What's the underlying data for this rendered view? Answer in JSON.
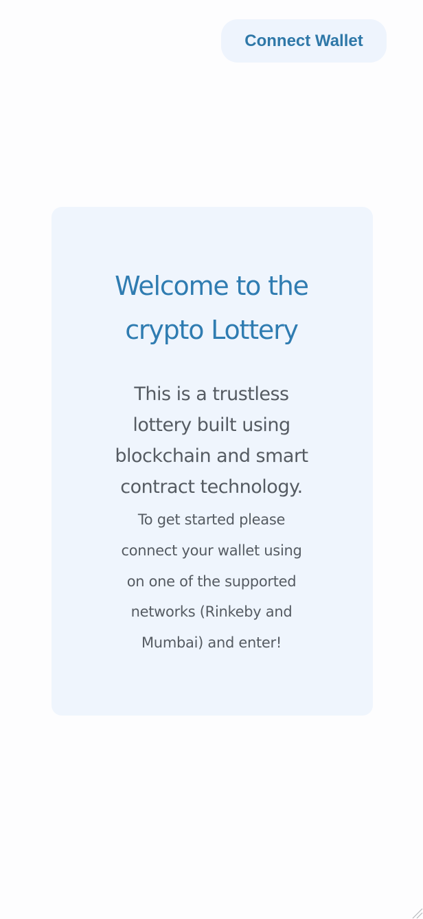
{
  "header": {
    "connect_wallet_label": "Connect Wallet"
  },
  "card": {
    "title_lines": [
      "Welcome to the",
      "crypto Lottery"
    ],
    "lead_lines": [
      "This is a trustless",
      "lottery built using",
      "blockchain and smart",
      "contract technology."
    ],
    "sub_lines": [
      "To get started please",
      "connect your wallet using",
      "on one of the supported",
      "networks (Rinkeby and",
      "Mumbai) and enter!"
    ]
  },
  "colors": {
    "accent": "#2f7cb1",
    "card_background": "#eff5fd",
    "button_background": "#eef4fd",
    "body_text": "#555b62"
  },
  "icons": {
    "corner": "resize-handle-icon"
  }
}
